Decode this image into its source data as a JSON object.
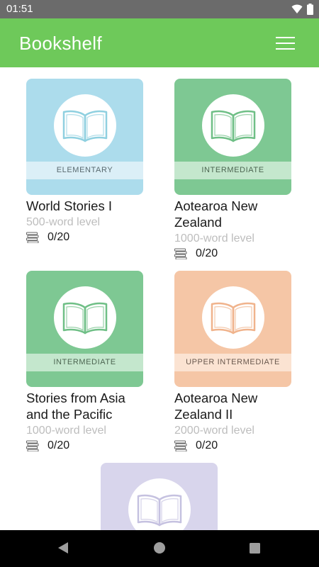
{
  "status": {
    "time": "01:51"
  },
  "app_bar": {
    "title": "Bookshelf",
    "menu_icon": "hamburger-menu-icon"
  },
  "books": [
    {
      "title": "World Stories I",
      "word_level": "500-word level",
      "level": "ELEMENTARY",
      "progress": "0/20",
      "colors": {
        "cover": "#acdcec",
        "strip": "#dbeff7",
        "icon": "#8fd0e0",
        "strip_text": "#5a6a70"
      }
    },
    {
      "title": "Aotearoa New Zealand",
      "word_level": "1000-word level",
      "level": "INTERMEDIATE",
      "progress": "0/20",
      "colors": {
        "cover": "#7ec893",
        "strip": "#c4e7cd",
        "icon": "#6fbf86",
        "strip_text": "#4d6652"
      }
    },
    {
      "title": "Stories from Asia and the Pacific",
      "word_level": "1000-word level",
      "level": "INTERMEDIATE",
      "progress": "0/20",
      "colors": {
        "cover": "#7ec893",
        "strip": "#c4e7cd",
        "icon": "#6fbf86",
        "strip_text": "#4d6652"
      }
    },
    {
      "title": "Aotearoa New Zealand II",
      "word_level": "2000-word level",
      "level": "UPPER INTERMEDIATE",
      "progress": "0/20",
      "colors": {
        "cover": "#f5c6a6",
        "strip": "#fbe3d2",
        "icon": "#f0b38c",
        "strip_text": "#6b5a4f"
      }
    },
    {
      "title": "",
      "word_level": "",
      "level": "",
      "progress": "",
      "colors": {
        "cover": "#d8d5ec",
        "strip": "#ebe9f5",
        "icon": "#c5c1e0",
        "strip_text": "#5d5a70"
      }
    }
  ],
  "icons": {
    "book": "open-book-icon",
    "progress": "stacked-books-icon",
    "wifi": "wifi-icon",
    "battery": "battery-icon"
  },
  "nav": {
    "back": "back-icon",
    "home": "home-icon",
    "recents": "recents-icon"
  }
}
